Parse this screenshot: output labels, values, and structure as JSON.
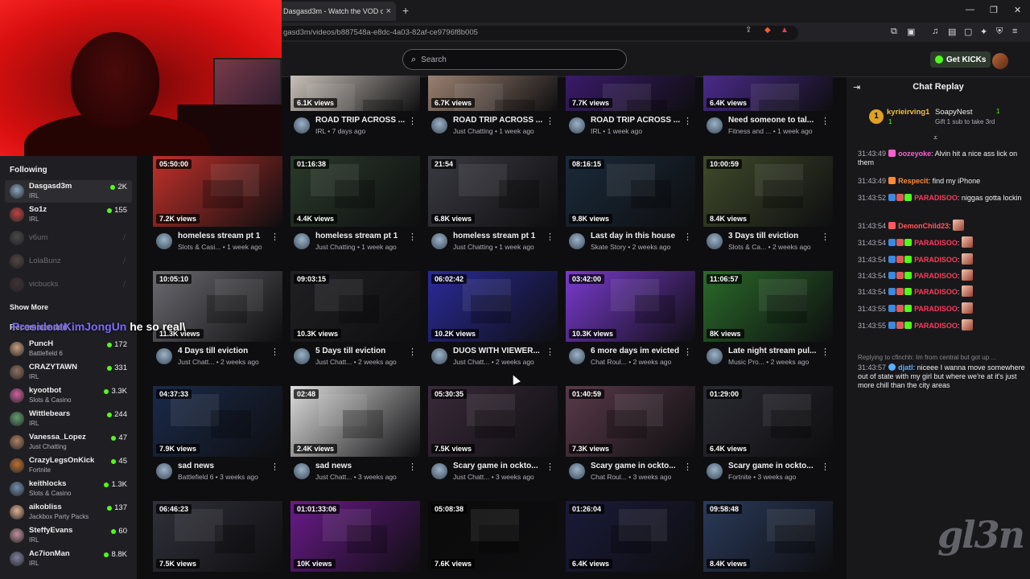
{
  "browser": {
    "tab_title": "Dasgasd3m - Watch the VOD on",
    "tab_close": "×",
    "new_tab": "+",
    "url": "gasd3m/videos/b887548a-e8dc-4a03-82af-ce9796f8b005",
    "window_controls": [
      "—",
      "❐",
      "✕"
    ]
  },
  "header": {
    "search_placeholder": "Search",
    "get_kicks_label": "Get KICKs"
  },
  "sidebar": {
    "following_label": "Following",
    "show_more_label": "Show More",
    "recommended_label": "Recommended",
    "following": [
      {
        "name": "Dasgasd3m",
        "category": "IRL",
        "count": "2K",
        "online": true,
        "color": "#8aa6c2"
      },
      {
        "name": "So1z",
        "category": "IRL",
        "count": "155",
        "online": true,
        "color": "#c04040"
      },
      {
        "name": "v6um",
        "category": "",
        "count": "",
        "online": false,
        "color": "#888888"
      },
      {
        "name": "LolaBunz",
        "category": "",
        "count": "",
        "online": false,
        "color": "#a08070"
      },
      {
        "name": "vicbucks",
        "category": "",
        "count": "",
        "online": false,
        "color": "#705050"
      }
    ],
    "recommended": [
      {
        "name": "PuncH",
        "category": "Battlefield 6",
        "count": "172",
        "color": "#c8a080"
      },
      {
        "name": "CRAZYTAWN",
        "category": "IRL",
        "count": "331",
        "color": "#907060"
      },
      {
        "name": "kyootbot",
        "category": "Slots & Casino",
        "count": "3.3K",
        "color": "#d060a0"
      },
      {
        "name": "Wittlebears",
        "category": "IRL",
        "count": "244",
        "color": "#60a070"
      },
      {
        "name": "Vanessa_Lopez",
        "category": "Just Chatting",
        "count": "47",
        "color": "#b08060"
      },
      {
        "name": "CrazyLegsOnKick",
        "category": "Fortnite",
        "count": "45",
        "color": "#c07030"
      },
      {
        "name": "keithlocks",
        "category": "Slots & Casino",
        "count": "1.3K",
        "color": "#7090b0"
      },
      {
        "name": "aikobliss",
        "category": "Jackbox Party Packs",
        "count": "137",
        "color": "#e0b090"
      },
      {
        "name": "SteffyEvans",
        "category": "IRL",
        "count": "60",
        "color": "#c090a0"
      },
      {
        "name": "Ac7ionMan",
        "category": "IRL",
        "count": "8.8K",
        "color": "#8080a0"
      }
    ]
  },
  "overlay": {
    "name": "PresidentKimJongUn",
    "text": "he so real\\"
  },
  "videos": [
    {
      "dur": "",
      "views": "6.1K views",
      "title": "ROAD TRIP ACROSS ...",
      "meta": "IRL • 7 days ago",
      "color": "#c8c0b8"
    },
    {
      "dur": "",
      "views": "6.7K views",
      "title": "ROAD TRIP ACROSS ...",
      "meta": "Just Chatting • 1 week ago",
      "color": "#9a8070"
    },
    {
      "dur": "",
      "views": "7.7K views",
      "title": "ROAD TRIP ACROSS ...",
      "meta": "IRL • 1 week ago",
      "color": "#3a1a6a"
    },
    {
      "dur": "",
      "views": "6.4K views",
      "title": "Need someone to tal...",
      "meta": "Fitness and ... • 1 week ago",
      "color": "#4a2a8a"
    },
    {
      "dur": "05:50:00",
      "views": "7.2K views",
      "title": "homeless stream pt 1",
      "meta": "Slots & Casi... • 1 week ago",
      "color": "#c0302a"
    },
    {
      "dur": "01:16:38",
      "views": "4.4K views",
      "title": "homeless stream pt 1",
      "meta": "Just Chatting • 1 week ago",
      "color": "#2a3a2a"
    },
    {
      "dur": "21:54",
      "views": "6.8K views",
      "title": "homeless stream pt 1",
      "meta": "Just Chatting • 1 week ago",
      "color": "#3a3a42"
    },
    {
      "dur": "08:16:15",
      "views": "9.8K views",
      "title": "Last day in this house",
      "meta": "Skate Story • 2 weeks ago",
      "color": "#1a2a3a"
    },
    {
      "dur": "10:00:59",
      "views": "8.4K views",
      "title": "3 Days till eviction",
      "meta": "Slots & Ca... • 2 weeks ago",
      "color": "#404a2a"
    },
    {
      "dur": "10:05:10",
      "views": "11.3K views",
      "title": "4 Days till eviction",
      "meta": "Just Chatt... • 2 weeks ago",
      "color": "#6a6a70"
    },
    {
      "dur": "09:03:15",
      "views": "10.3K views",
      "title": "5 Days till eviction",
      "meta": "Just Chatt... • 2 weeks ago",
      "color": "#202024"
    },
    {
      "dur": "06:02:42",
      "views": "10.2K views",
      "title": "DUOS WITH VIEWER...",
      "meta": "Just Chatt... • 2 weeks ago",
      "color": "#2a2a9a"
    },
    {
      "dur": "03:42:00",
      "views": "10.3K views",
      "title": "6 more days im evicted",
      "meta": "Chat Roul... • 2 weeks ago",
      "color": "#7a3ad0"
    },
    {
      "dur": "11:06:57",
      "views": "8K views",
      "title": "Late night stream pul...",
      "meta": "Music Pro... • 2 weeks ago",
      "color": "#2a6a2a"
    },
    {
      "dur": "04:37:33",
      "views": "7.9K views",
      "title": "sad news",
      "meta": "Battlefield 6 • 3 weeks ago",
      "color": "#1a2a4a"
    },
    {
      "dur": "02:48",
      "views": "2.4K views",
      "title": "sad news",
      "meta": "Just Chatt... • 3 weeks ago",
      "color": "#dcdcdc"
    },
    {
      "dur": "05:30:35",
      "views": "7.5K views",
      "title": "Scary game in ockto...",
      "meta": "Just Chatt... • 3 weeks ago",
      "color": "#3a2a3a"
    },
    {
      "dur": "01:40:59",
      "views": "7.3K views",
      "title": "Scary game in ockto...",
      "meta": "Chat Roul... • 3 weeks ago",
      "color": "#5a3a4a"
    },
    {
      "dur": "01:29:00",
      "views": "6.4K views",
      "title": "Scary game in ockto...",
      "meta": "Fortnite • 3 weeks ago",
      "color": "#2a2a32"
    },
    {
      "dur": "06:46:23",
      "views": "7.5K views",
      "title": "",
      "meta": "",
      "color": "#30303a"
    },
    {
      "dur": "01:01:33:06",
      "views": "10K views",
      "title": "",
      "meta": "",
      "color": "#6a1a8a"
    },
    {
      "dur": "05:08:38",
      "views": "7.6K views",
      "title": "",
      "meta": "",
      "color": "#0a0a0a"
    },
    {
      "dur": "01:26:04",
      "views": "6.4K views",
      "title": "",
      "meta": "",
      "color": "#1a1a3a"
    },
    {
      "dur": "09:58:48",
      "views": "8.4K views",
      "title": "",
      "meta": "",
      "color": "#2a3a5a"
    }
  ],
  "chat": {
    "title": "Chat Replay",
    "pinned": {
      "rank": "1",
      "user1": "kyrieirving1",
      "user1_count": "1",
      "user2": "SoapyNest",
      "user2_count": "1",
      "gift_text": "Gift 1 sub to take 3rd"
    },
    "messages": [
      {
        "ts": "31:43:49",
        "user": "oozeyoke",
        "color": "#ff5fd0",
        "text": ": Alvin hit a nice ass lick on them"
      },
      {
        "ts": "31:43:49",
        "user": "Respecit",
        "color": "#ff8a3a",
        "text": ": find my iPhone"
      },
      {
        "ts": "31:43:52",
        "user": "PARADISOO",
        "color": "#ff3a5a",
        "text": ": niggas gotta lockin"
      },
      {
        "ts": "31:43:54",
        "user": "DemonChild23",
        "color": "#ff5a5a",
        "text": ":"
      },
      {
        "ts": "31:43:54",
        "user": "PARADISOO",
        "color": "#ff3a5a",
        "text": ":"
      },
      {
        "ts": "31:43:54",
        "user": "PARADISOO",
        "color": "#ff3a5a",
        "text": ":"
      },
      {
        "ts": "31:43:54",
        "user": "PARADISOO",
        "color": "#ff3a5a",
        "text": ":"
      },
      {
        "ts": "31:43:54",
        "user": "PARADISOO",
        "color": "#ff3a5a",
        "text": ":"
      },
      {
        "ts": "31:43:55",
        "user": "PARADISOO",
        "color": "#ff3a5a",
        "text": ":"
      },
      {
        "ts": "31:43:55",
        "user": "PARADISOO",
        "color": "#ff3a5a",
        "text": ":"
      }
    ],
    "reply_to": "Replying to cfinchh: Im from central but got up ...",
    "reply_msg": {
      "ts": "31:43:57",
      "user": "djatl",
      "color": "#5ab0ff",
      "text": ": niceee I wanna move somewhere out of state with my girl but where we're at it's just more chill than the city areas"
    }
  },
  "watermark": "gl3n"
}
